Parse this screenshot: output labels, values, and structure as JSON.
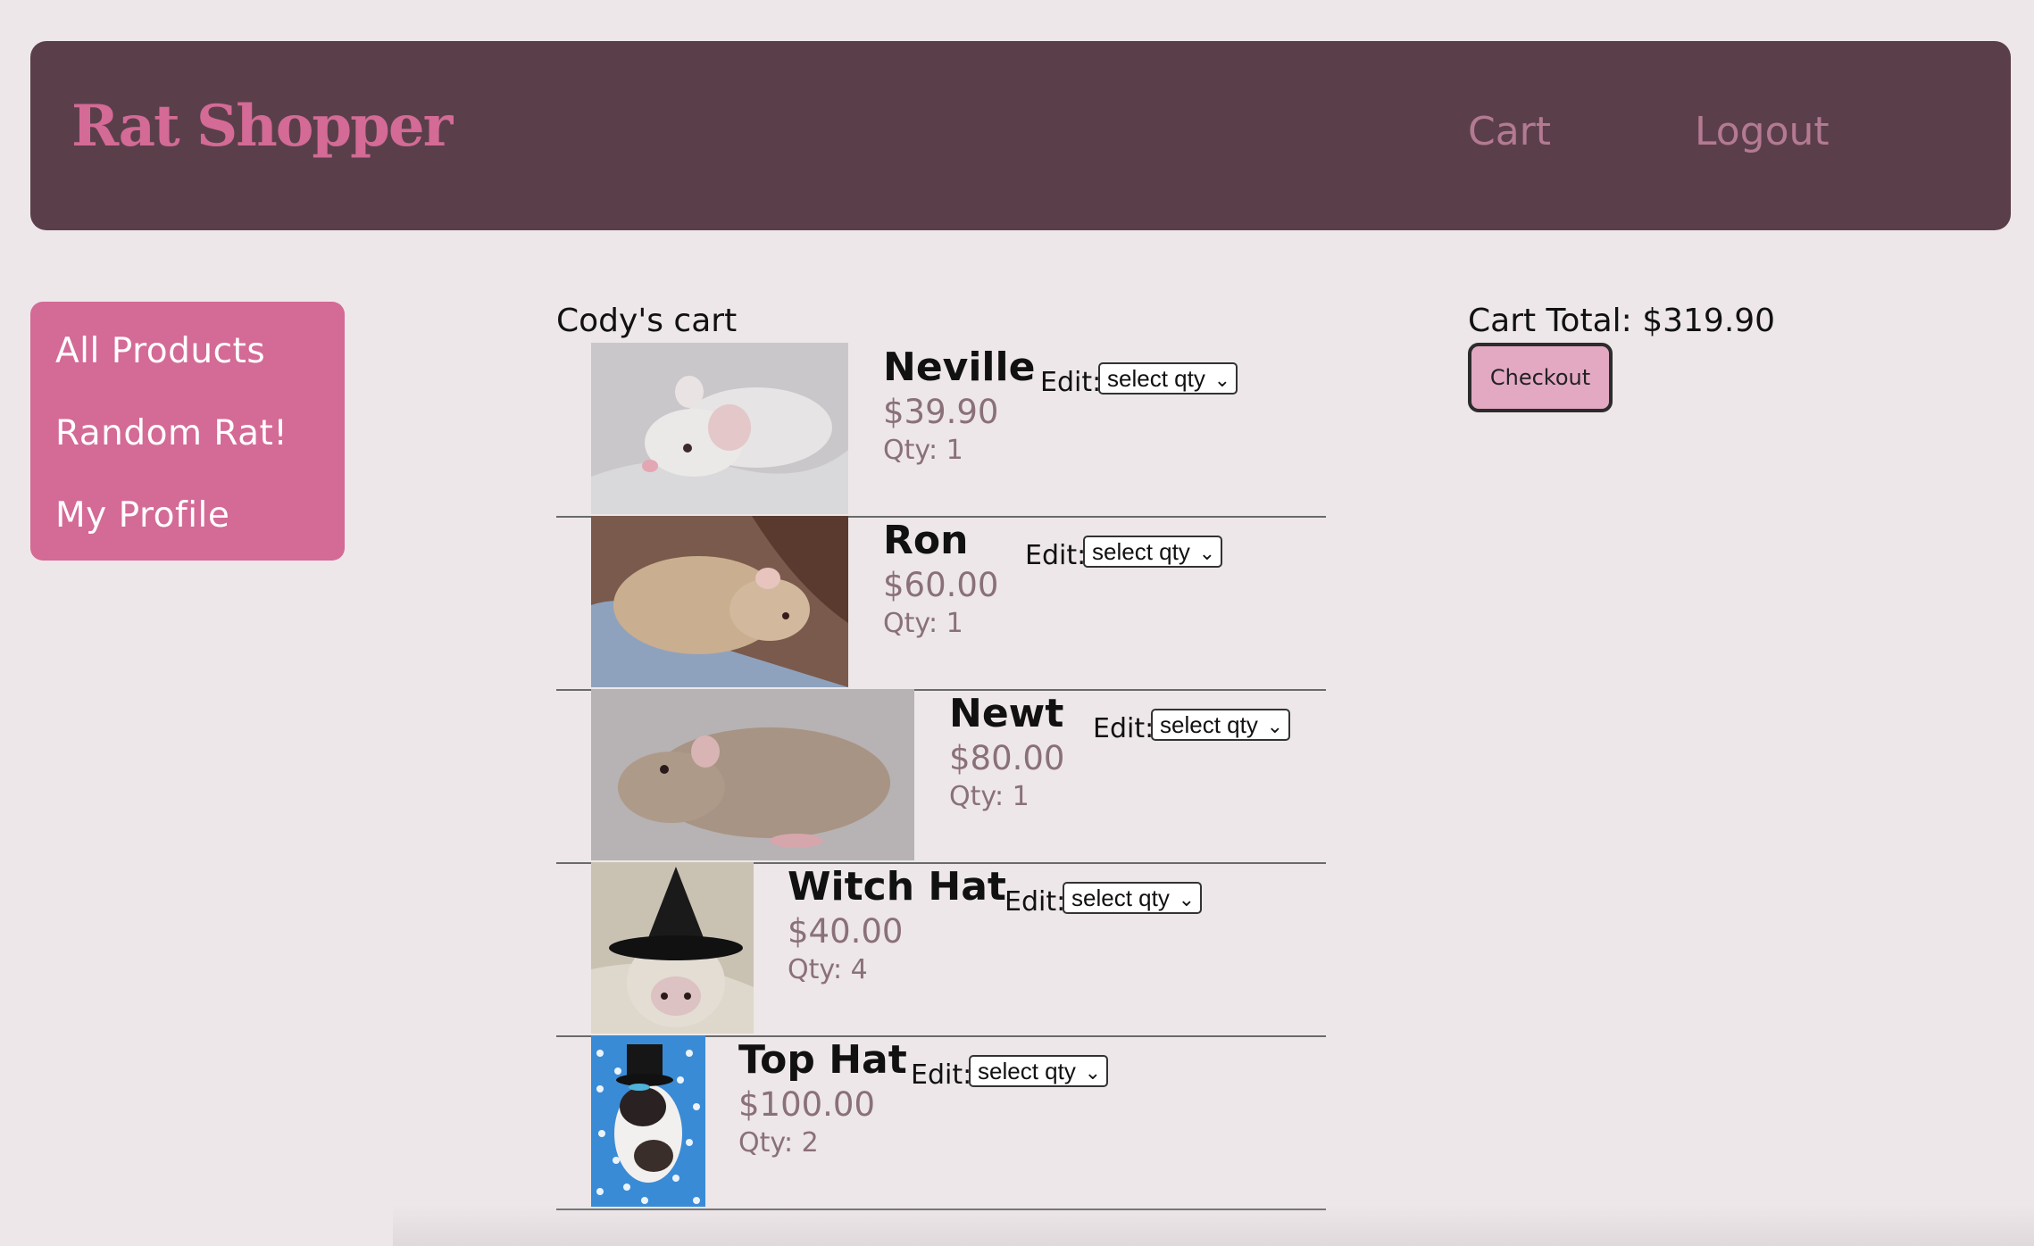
{
  "header": {
    "logo": "Rat Shopper",
    "nav": {
      "cart": "Cart",
      "logout": "Logout"
    }
  },
  "sidebar": {
    "items": [
      {
        "label": "All Products"
      },
      {
        "label": "Random Rat!"
      },
      {
        "label": "My Profile"
      }
    ]
  },
  "cart": {
    "title": "Cody's cart",
    "edit_label": "Edit:",
    "select_placeholder": "select qty",
    "items": [
      {
        "name": "Neville",
        "price": "$39.90",
        "qty": "Qty: 1"
      },
      {
        "name": "Ron",
        "price": "$60.00",
        "qty": "Qty: 1"
      },
      {
        "name": "Newt",
        "price": "$80.00",
        "qty": "Qty: 1"
      },
      {
        "name": "Witch Hat",
        "price": "$40.00",
        "qty": "Qty: 4"
      },
      {
        "name": "Top Hat",
        "price": "$100.00",
        "qty": "Qty: 2"
      }
    ]
  },
  "summary": {
    "total": "Cart Total: $319.90",
    "checkout_label": "Checkout"
  },
  "colors": {
    "header_bg": "#5a3f4b",
    "brand_pink": "#d46a96",
    "page_bg": "#ede7e9",
    "checkout_bg": "#e3a9c3"
  }
}
